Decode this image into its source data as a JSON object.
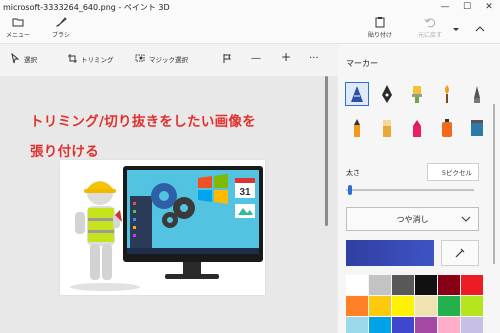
{
  "window": {
    "title": "microsoft-3333264_640.png - ペイント 3D",
    "controls": [
      "—",
      "☐",
      "✕"
    ]
  },
  "ribbon": {
    "menu_label": "メニュー",
    "brushes_label": "ブラシ",
    "paste_label": "貼り付け",
    "redo_label": "元に戻す"
  },
  "toolbar": {
    "select_label": "選択",
    "crop_label": "トリミング",
    "magic_select_label": "マジック選択",
    "minus": "—",
    "plus": "+",
    "more": "···"
  },
  "canvas": {
    "line1": "トリミング/切り抜きをしたい画像を",
    "line2": "張り付ける",
    "text_color": "#e0302d"
  },
  "panel": {
    "title": "マーカー",
    "thickness_label": "太さ",
    "thickness_value": "5ピクセル",
    "finish_value": "つや消し",
    "current_color": "#3646b4",
    "brushes": [
      {
        "name": "marker-brush-icon",
        "selected": true
      },
      {
        "name": "calligraphy-pen-icon",
        "selected": false
      },
      {
        "name": "oil-brush-icon",
        "selected": false
      },
      {
        "name": "watercolor-brush-icon",
        "selected": false
      },
      {
        "name": "pixel-pen-icon",
        "selected": false
      },
      {
        "name": "pencil-icon",
        "selected": false
      },
      {
        "name": "eraser-icon",
        "selected": false
      },
      {
        "name": "crayon-icon",
        "selected": false
      },
      {
        "name": "spray-can-icon",
        "selected": false
      },
      {
        "name": "fill-bucket-icon",
        "selected": false
      }
    ],
    "palette": [
      "#ffffff",
      "#c3c3c3",
      "#585858",
      "#111111",
      "#880015",
      "#ed1c24",
      "#ff7f27",
      "#ffc90e",
      "#fff200",
      "#efe4b0",
      "#22b14c",
      "#b5e61d",
      "#99d9ea",
      "#00a2e8",
      "#3f48cc",
      "#a349a4",
      "#ffaec9",
      "#c8bfe7"
    ]
  }
}
